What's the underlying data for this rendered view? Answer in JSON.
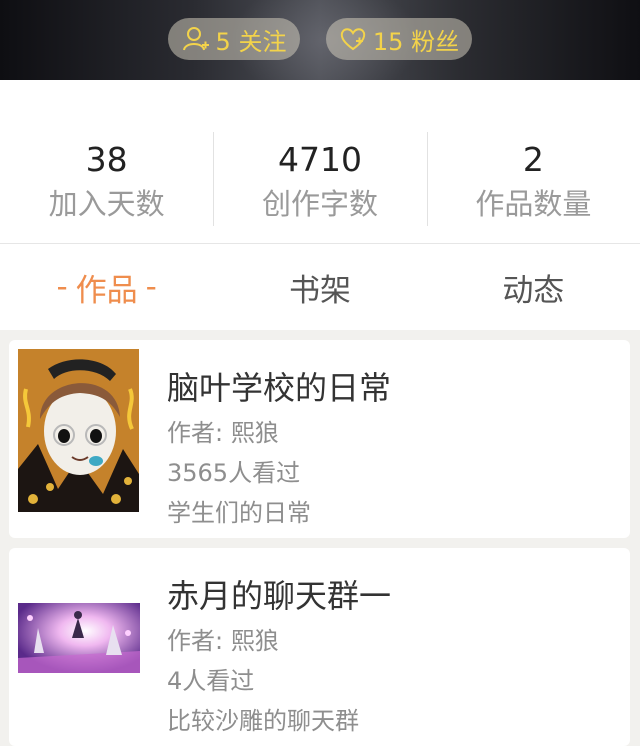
{
  "profile": {
    "following": "5 关注",
    "fans": "15 粉丝"
  },
  "stats": [
    {
      "value": "38",
      "label": "加入天数"
    },
    {
      "value": "4710",
      "label": "创作字数"
    },
    {
      "value": "2",
      "label": "作品数量"
    }
  ],
  "tabs": [
    {
      "label": "作品",
      "active": true
    },
    {
      "label": "书架",
      "active": false
    },
    {
      "label": "动态",
      "active": false
    }
  ],
  "tab_dash": "-",
  "works": [
    {
      "title": "脑叶学校的日常",
      "author": "作者: 熙狼",
      "views": "3565人看过",
      "description": "学生们的日常"
    },
    {
      "title": "赤月的聊天群一",
      "author": "作者: 熙狼",
      "views": "4人看过",
      "description": "比较沙雕的聊天群"
    }
  ],
  "colors": {
    "accent": "#ef8d4d",
    "pill_text": "#f3d34a"
  },
  "icons": {
    "following": "person-add-icon",
    "fans": "heart-icon"
  }
}
